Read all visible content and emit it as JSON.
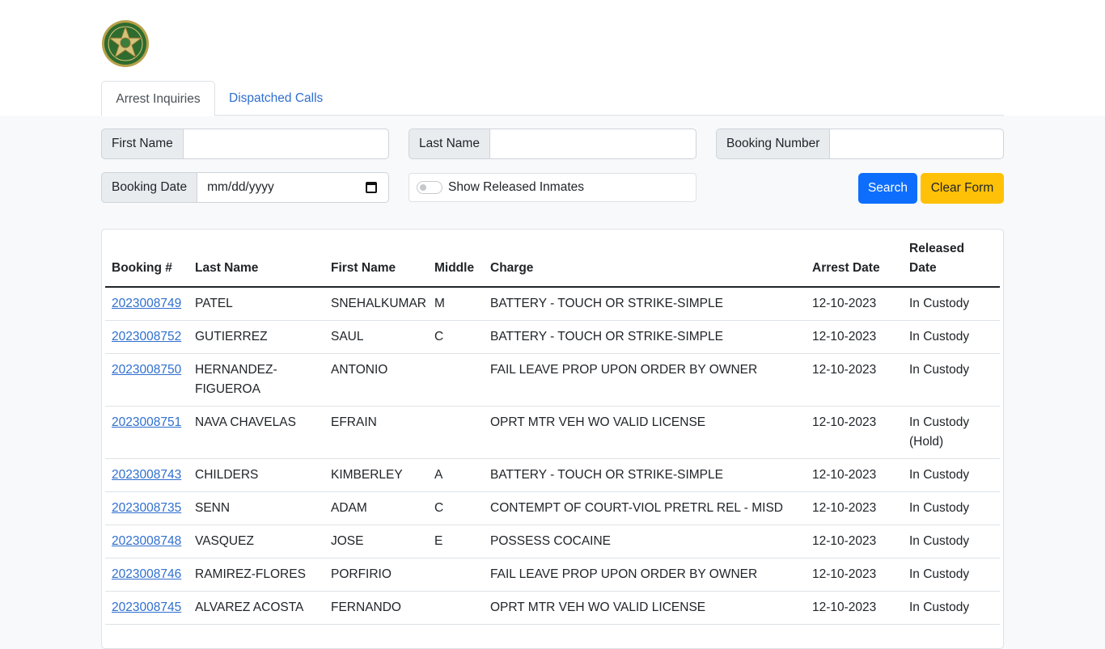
{
  "tabs": [
    {
      "label": "Arrest Inquiries"
    },
    {
      "label": "Dispatched Calls"
    }
  ],
  "form": {
    "first_name_label": "First Name",
    "first_name_value": "",
    "last_name_label": "Last Name",
    "last_name_value": "",
    "booking_number_label": "Booking Number",
    "booking_number_value": "",
    "booking_date_label": "Booking Date",
    "booking_date_placeholder": "mm/dd/yyyy",
    "show_released_label": "Show Released Inmates",
    "search_label": "Search",
    "clear_label": "Clear Form"
  },
  "colors": {
    "primary": "#0d6efd",
    "warning": "#ffc107",
    "link": "#2f6fce"
  },
  "table": {
    "headers": [
      "Booking #",
      "Last Name",
      "First Name",
      "Middle",
      "Charge",
      "Arrest Date",
      "Released Date"
    ],
    "rows": [
      [
        "2023008749",
        "PATEL",
        "SNEHALKUMAR",
        "M",
        "BATTERY - TOUCH OR STRIKE-SIMPLE",
        "12-10-2023",
        "In Custody"
      ],
      [
        "2023008752",
        "GUTIERREZ",
        "SAUL",
        "C",
        "BATTERY - TOUCH OR STRIKE-SIMPLE",
        "12-10-2023",
        "In Custody"
      ],
      [
        "2023008750",
        "HERNANDEZ-FIGUEROA",
        "ANTONIO",
        "",
        "FAIL LEAVE PROP UPON ORDER BY OWNER",
        "12-10-2023",
        "In Custody"
      ],
      [
        "2023008751",
        "NAVA CHAVELAS",
        "EFRAIN",
        "",
        "OPRT MTR VEH WO VALID LICENSE",
        "12-10-2023",
        "In Custody (Hold)"
      ],
      [
        "2023008743",
        "CHILDERS",
        "KIMBERLEY",
        "A",
        "BATTERY - TOUCH OR STRIKE-SIMPLE",
        "12-10-2023",
        "In Custody"
      ],
      [
        "2023008735",
        "SENN",
        "ADAM",
        "C",
        "CONTEMPT OF COURT-VIOL PRETRL REL - MISD",
        "12-10-2023",
        "In Custody"
      ],
      [
        "2023008748",
        "VASQUEZ",
        "JOSE",
        "E",
        "POSSESS COCAINE",
        "12-10-2023",
        "In Custody"
      ],
      [
        "2023008746",
        "RAMIREZ-FLORES",
        "PORFIRIO",
        "",
        "FAIL LEAVE PROP UPON ORDER BY OWNER",
        "12-10-2023",
        "In Custody"
      ],
      [
        "2023008745",
        "ALVAREZ ACOSTA",
        "FERNANDO",
        "",
        "OPRT MTR VEH WO VALID LICENSE",
        "12-10-2023",
        "In Custody"
      ]
    ]
  }
}
